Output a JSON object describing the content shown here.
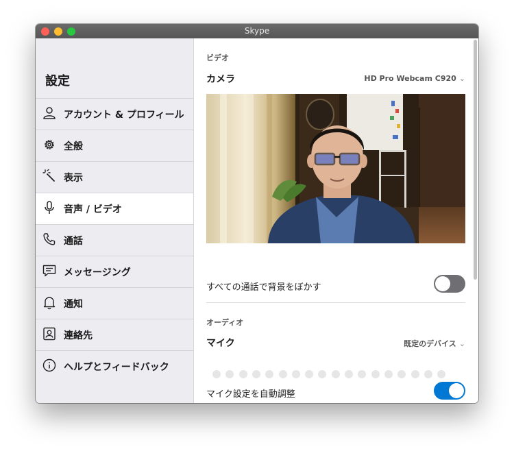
{
  "window": {
    "title": "Skype"
  },
  "sidebar": {
    "title": "設定",
    "items": [
      {
        "label": "アカウント & プロフィール",
        "icon": "person-icon",
        "active": false
      },
      {
        "label": "全般",
        "icon": "gear-icon",
        "active": false
      },
      {
        "label": "表示",
        "icon": "magic-wand-icon",
        "active": false
      },
      {
        "label": "音声 / ビデオ",
        "icon": "microphone-icon",
        "active": true
      },
      {
        "label": "通話",
        "icon": "phone-icon",
        "active": false
      },
      {
        "label": "メッセージング",
        "icon": "message-icon",
        "active": false
      },
      {
        "label": "通知",
        "icon": "bell-icon",
        "active": false
      },
      {
        "label": "連絡先",
        "icon": "contact-card-icon",
        "active": false
      },
      {
        "label": "ヘルプとフィードバック",
        "icon": "info-icon",
        "active": false
      }
    ]
  },
  "video": {
    "section_title": "ビデオ",
    "camera_label": "カメラ",
    "camera_device": "HD Pro Webcam C920",
    "blur_label": "すべての通話で背景をぼかす",
    "blur_enabled": false
  },
  "audio": {
    "section_title": "オーディオ",
    "mic_label": "マイク",
    "mic_device": "既定のデバイス",
    "mic_level_dots": 18,
    "mic_level": 0,
    "auto_adjust_label": "マイク設定を自動調整",
    "auto_adjust_enabled": true
  },
  "colors": {
    "accent": "#0078d4",
    "toggle_off": "#6e6e73",
    "sidebar_bg": "#ececf1"
  }
}
